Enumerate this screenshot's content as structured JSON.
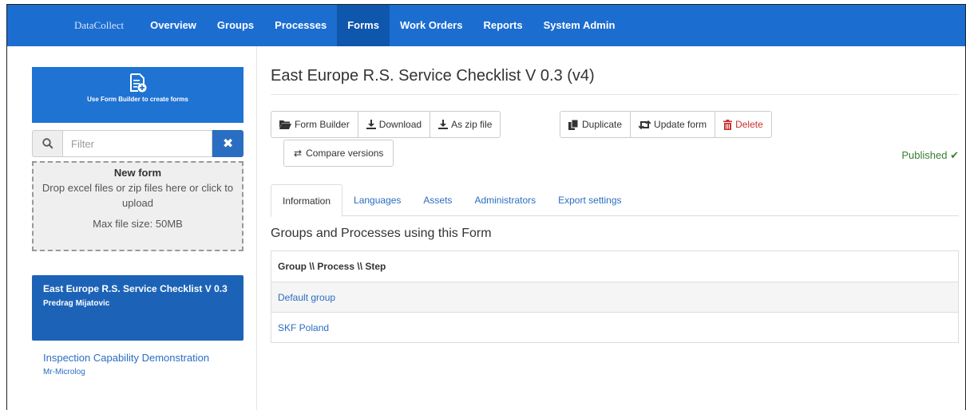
{
  "navbar": {
    "brand": "DataCollect",
    "items": [
      {
        "label": "Overview",
        "active": false
      },
      {
        "label": "Groups",
        "active": false
      },
      {
        "label": "Processes",
        "active": false
      },
      {
        "label": "Forms",
        "active": true
      },
      {
        "label": "Work Orders",
        "active": false
      },
      {
        "label": "Reports",
        "active": false
      },
      {
        "label": "System Admin",
        "active": false
      }
    ]
  },
  "sidebar": {
    "builder_text": "Use Form Builder to create forms",
    "filter_placeholder": "Filter",
    "dropzone": {
      "title": "New form",
      "text": "Drop excel files or zip files here or click to upload",
      "max_size": "Max file size: 50MB"
    },
    "forms": [
      {
        "title": "East Europe R.S. Service Checklist V 0.3",
        "author": "Predrag Mijatovic",
        "active": true
      },
      {
        "title": "Inspection Capability Demonstration",
        "author": "Mr-Microlog",
        "active": false
      }
    ]
  },
  "main": {
    "title": "East Europe R.S. Service Checklist V 0.3 (v4)",
    "buttons": {
      "form_builder": "Form Builder",
      "download": "Download",
      "zip": "As zip file",
      "duplicate": "Duplicate",
      "update": "Update form",
      "delete": "Delete",
      "compare": "Compare versions"
    },
    "status": "Published",
    "tabs": [
      "Information",
      "Languages",
      "Assets",
      "Administrators",
      "Export settings"
    ],
    "section_title": "Groups and Processes using this Form",
    "table": {
      "header": "Group \\\\ Process \\\\ Step",
      "rows": [
        "Default group",
        "SKF Poland"
      ]
    }
  },
  "colors": {
    "navbar": "#1c6dd0",
    "active_nav": "#0f56ad",
    "link": "#2a6ec1",
    "published": "#3a7d34",
    "danger": "#c9302c"
  }
}
